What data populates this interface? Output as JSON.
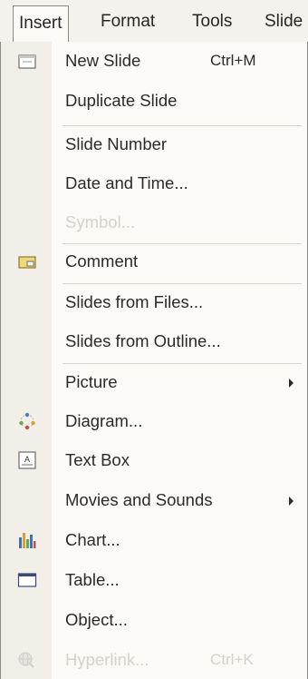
{
  "menubar": {
    "items": [
      {
        "label": "Insert",
        "active": true
      },
      {
        "label": "Format",
        "active": false
      },
      {
        "label": "Tools",
        "active": false
      },
      {
        "label": "Slide",
        "active": false
      }
    ]
  },
  "menu": {
    "items": [
      {
        "label": "New Slide",
        "shortcut": "Ctrl+M",
        "icon": "new-slide-icon",
        "enabled": true
      },
      {
        "label": "Duplicate Slide",
        "enabled": true
      },
      {
        "label": "Slide Number",
        "enabled": true
      },
      {
        "label": "Date and Time...",
        "enabled": true
      },
      {
        "label": "Symbol...",
        "enabled": false
      },
      {
        "label": "Comment",
        "icon": "comment-icon",
        "enabled": true
      },
      {
        "label": "Slides from Files...",
        "enabled": true
      },
      {
        "label": "Slides from Outline...",
        "enabled": true
      },
      {
        "label": "Picture",
        "submenu": true,
        "enabled": true
      },
      {
        "label": "Diagram...",
        "icon": "diagram-icon",
        "enabled": true
      },
      {
        "label": "Text Box",
        "icon": "text-box-icon",
        "enabled": true
      },
      {
        "label": "Movies and Sounds",
        "submenu": true,
        "enabled": true
      },
      {
        "label": "Chart...",
        "icon": "chart-icon",
        "enabled": true
      },
      {
        "label": "Table...",
        "icon": "table-icon",
        "enabled": true
      },
      {
        "label": "Object...",
        "enabled": true
      },
      {
        "label": "Hyperlink...",
        "shortcut": "Ctrl+K",
        "icon": "hyperlink-icon",
        "enabled": false
      }
    ]
  },
  "colors": {
    "menu_background": "#fbfaf6",
    "icon_gutter": "#f1efe8",
    "disabled_text": "#d4d2cb",
    "text": "#2a2a2a"
  }
}
